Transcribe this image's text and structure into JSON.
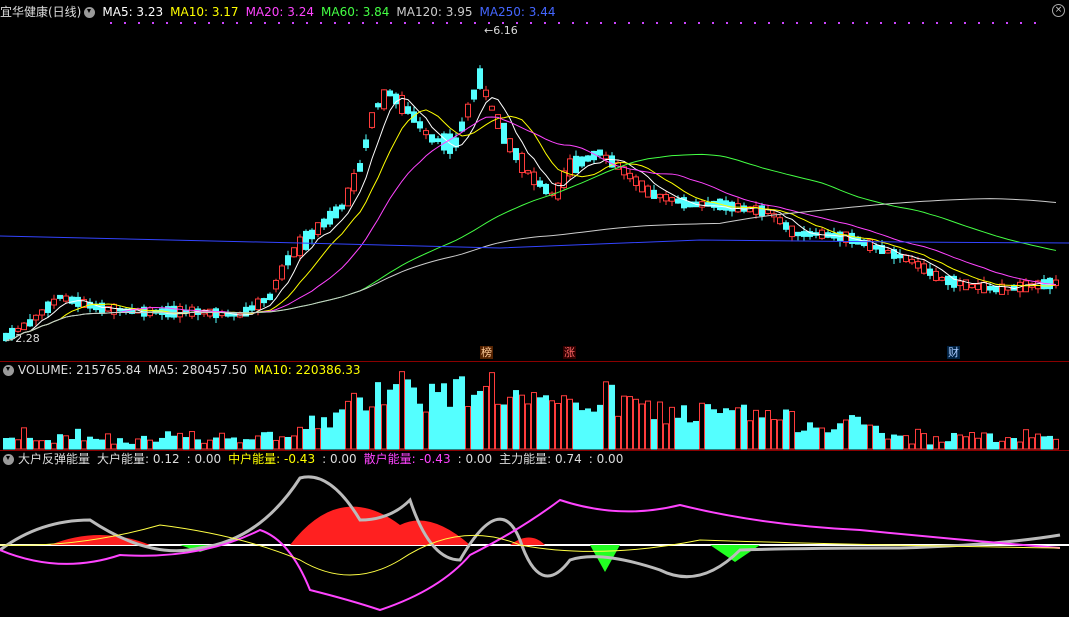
{
  "price_panel": {
    "stock_name": "宜华健康(日线)",
    "legend": [
      {
        "label": "MA5: 3.23",
        "color": "#ffffff"
      },
      {
        "label": "MA10: 3.17",
        "color": "#ffff00"
      },
      {
        "label": "MA20: 3.24",
        "color": "#ff44ff"
      },
      {
        "label": "MA60: 3.84",
        "color": "#44ff44"
      },
      {
        "label": "MA120: 3.95",
        "color": "#cccccc"
      },
      {
        "label": "MA250: 3.44",
        "color": "#4466ff"
      }
    ],
    "high_label": "6.16",
    "low_label": "2.28",
    "markers": [
      {
        "text": "榜",
        "color": "#ffcc99",
        "bg": "#552200"
      },
      {
        "text": "涨",
        "color": "#ff6666",
        "bg": "#330000"
      },
      {
        "text": "财",
        "color": "#aaccff",
        "bg": "#002244"
      }
    ]
  },
  "volume_panel": {
    "legend": [
      {
        "label": "VOLUME: 215765.84",
        "color": "#dddddd"
      },
      {
        "label": "MA5: 280457.50",
        "color": "#dddddd"
      },
      {
        "label": "MA10: 220386.33",
        "color": "#ffff00"
      }
    ]
  },
  "indicator_panel": {
    "legend": [
      {
        "label": "大户反弹能量",
        "color": "#dddddd"
      },
      {
        "label": "大户能量: 0.12",
        "color": "#dddddd"
      },
      {
        "label": ": 0.00",
        "color": "#dddddd"
      },
      {
        "label": "中户能量: -0.43",
        "color": "#ffff00"
      },
      {
        "label": ": 0.00",
        "color": "#dddddd"
      },
      {
        "label": "散户能量: -0.43",
        "color": "#ff44ff"
      },
      {
        "label": ": 0.00",
        "color": "#dddddd"
      },
      {
        "label": "主力能量: 0.74",
        "color": "#dddddd"
      },
      {
        "label": ": 0.00",
        "color": "#dddddd"
      }
    ]
  },
  "colors": {
    "up": "#ff3c3c",
    "down": "#54ffff",
    "grid": "#8a0000"
  }
}
